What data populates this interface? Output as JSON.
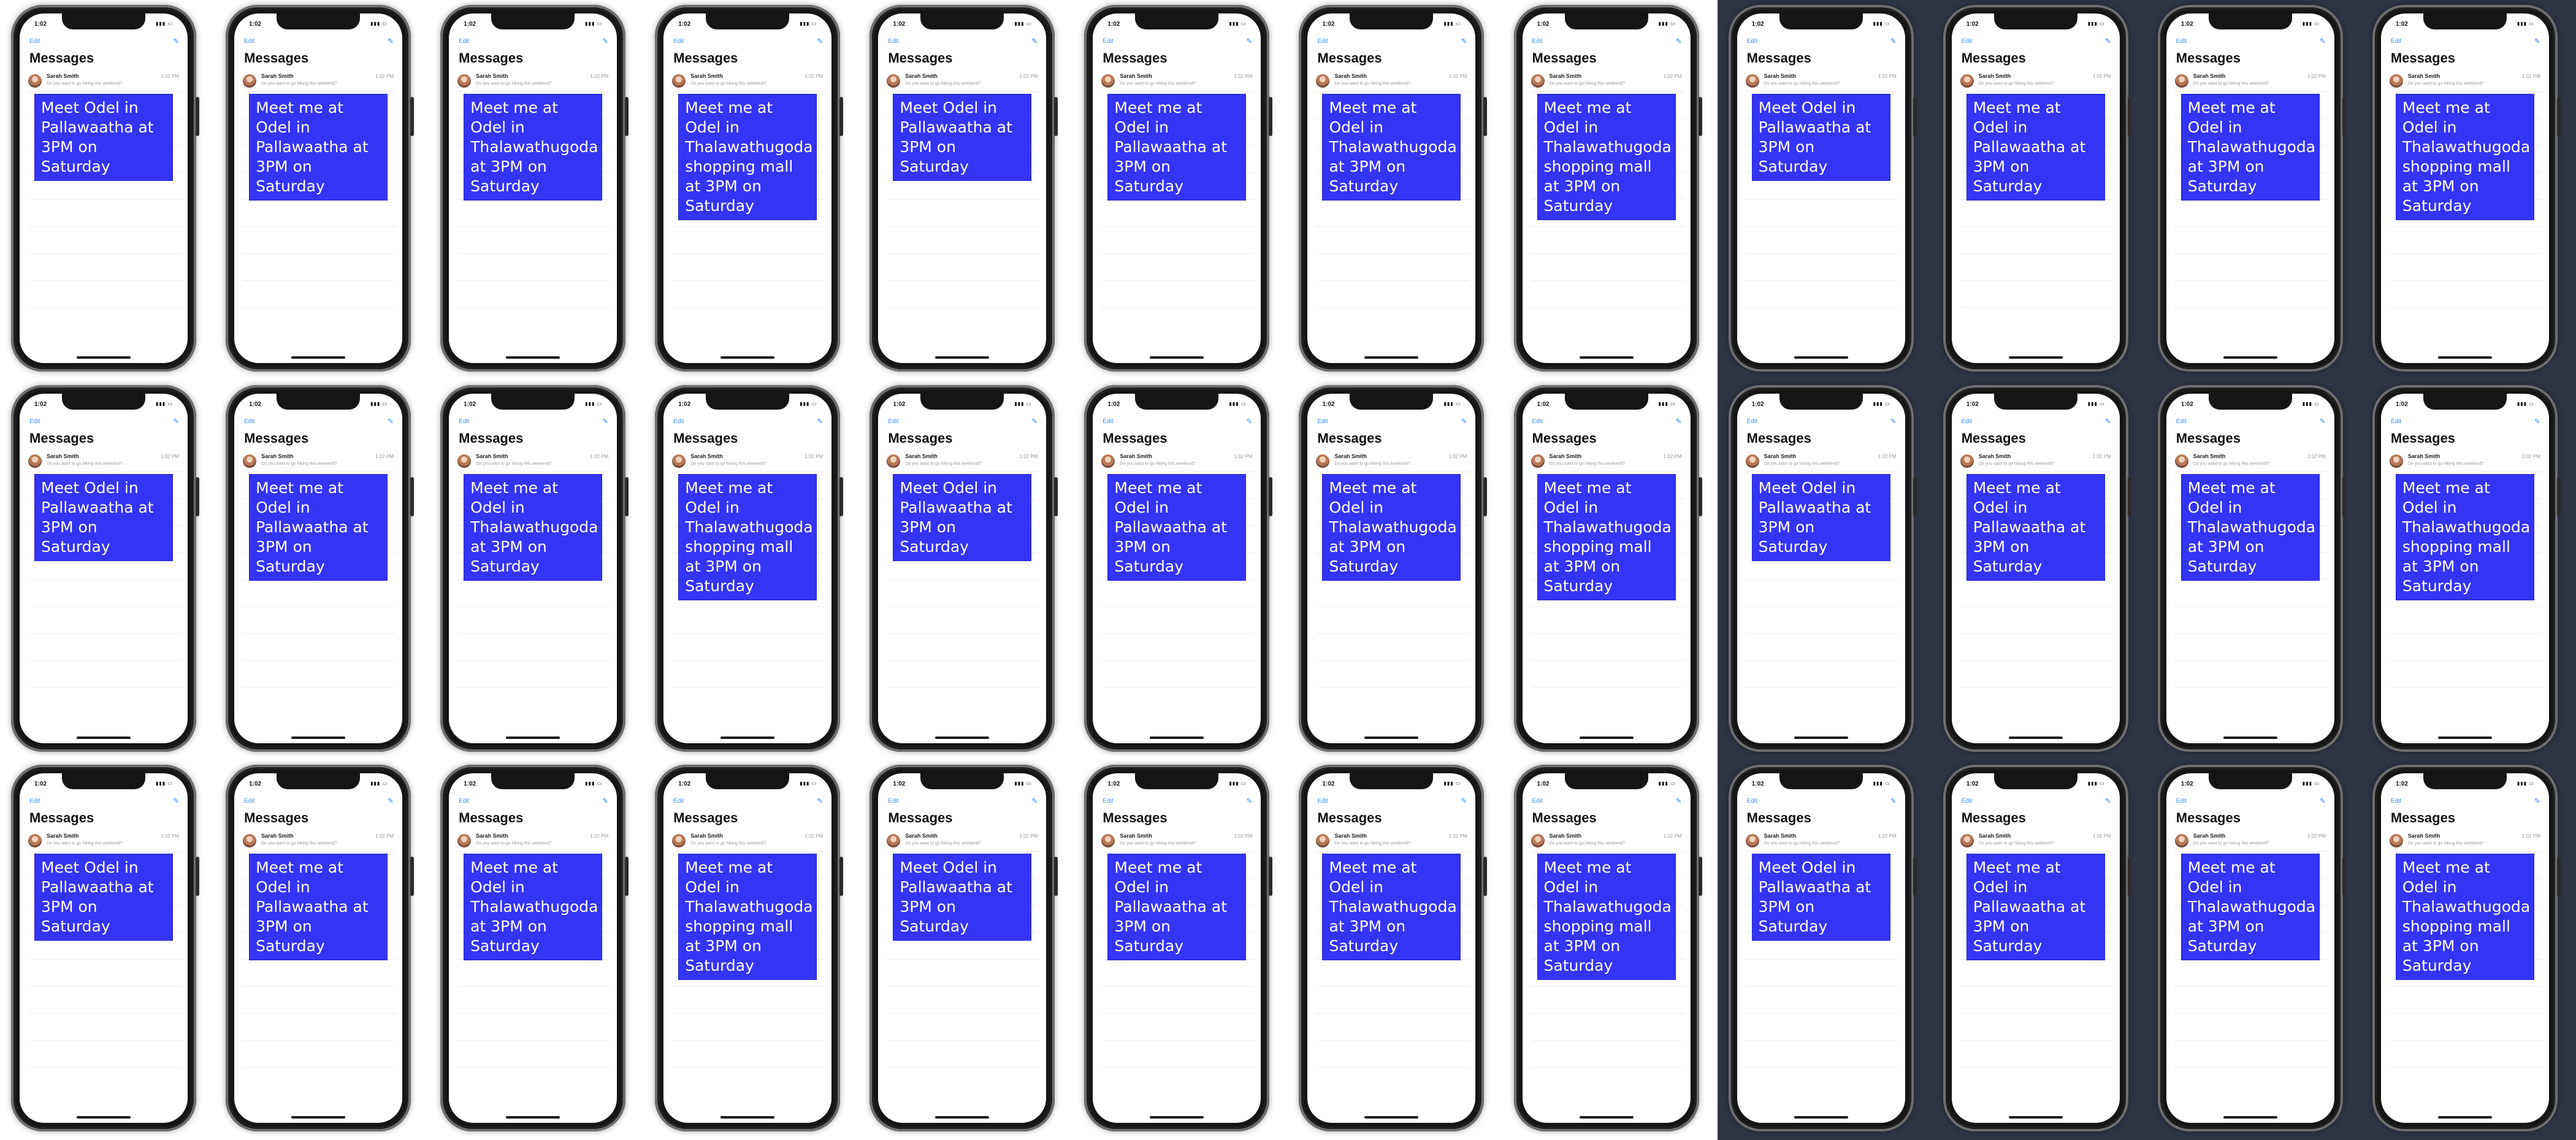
{
  "grid": [
    [
      "Meet Odel in Pallawaatha at 3PM on Saturday",
      "Meet me at Odel in Pallawaatha at 3PM on Saturday",
      "Meet me at Odel in Thalawathugoda at 3PM on Saturday",
      "Meet me at Odel in Thalawathugoda shopping mall at 3PM on Saturday",
      "Meet Odel in Pallawaatha at 3PM on Saturday",
      "Meet me at Odel in Pallawaatha at 3PM on Saturday",
      "Meet me at Odel in Thalawathugoda at 3PM on Saturday",
      "Meet me at Odel in Thalawathugoda shopping mall at 3PM on Saturday",
      "Meet Odel in Pallawaatha at 3PM on Saturday",
      "Meet me at Odel in Pallawaatha at 3PM on Saturday",
      "Meet me at Odel in Thalawathugoda at 3PM on Saturday",
      "Meet me at Odel in Thalawathugoda shopping mall at 3PM on Saturday"
    ],
    [
      "Meet Odel in Pallawaatha at 3PM on Saturday",
      "Meet me at Odel in Pallawaatha at 3PM on Saturday",
      "Meet me at Odel in Thalawathugoda at 3PM on Saturday",
      "Meet me at Odel in Thalawathugoda shopping mall at 3PM on Saturday",
      "Meet Odel in Pallawaatha at 3PM on Saturday",
      "Meet me at Odel in Pallawaatha at 3PM on Saturday",
      "Meet me at Odel in Thalawathugoda at 3PM on Saturday",
      "Meet me at Odel in Thalawathugoda shopping mall at 3PM on Saturday",
      "Meet Odel in Pallawaatha at 3PM on Saturday",
      "Meet me at Odel in Pallawaatha at 3PM on Saturday",
      "Meet me at Odel in Thalawathugoda at 3PM on Saturday",
      "Meet me at Odel in Thalawathugoda shopping mall at 3PM on Saturday"
    ],
    [
      "Meet Odel in Pallawaatha at 3PM on Saturday",
      "Meet me at Odel in Pallawaatha at 3PM on Saturday",
      "Meet me at Odel in Thalawathugoda at 3PM on Saturday",
      "Meet me at Odel in Thalawathugoda shopping mall at 3PM on Saturday",
      "Meet Odel in Pallawaatha at 3PM on Saturday",
      "Meet me at Odel in Pallawaatha at 3PM on Saturday",
      "Meet me at Odel in Thalawathugoda at 3PM on Saturday",
      "Meet me at Odel in Thalawathugoda shopping mall at 3PM on Saturday",
      "Meet Odel in Pallawaatha at 3PM on Saturday",
      "Meet me at Odel in Pallawaatha at 3PM on Saturday",
      "Meet me at Odel in Thalawathugoda at 3PM on Saturday",
      "Meet me at Odel in Thalawathugoda shopping mall at 3PM on Saturday"
    ]
  ],
  "phone_ui": {
    "status_time": "1:02",
    "status_icons": "▮▮▮ ▭",
    "edit_label": "Edit",
    "compose_icon": "compose-icon",
    "title": "Messages",
    "sender_name": "Sarah Smith",
    "thread_time": "1:02 PM",
    "thread_preview": "Do you want to go hiking this weekend?"
  },
  "colors": {
    "overlay_fill": "#3434f4",
    "overlay_text": "#ffffff",
    "background_dark": "#2f3545",
    "phone_frame": "#151515",
    "accent": "#3b8ff0"
  }
}
